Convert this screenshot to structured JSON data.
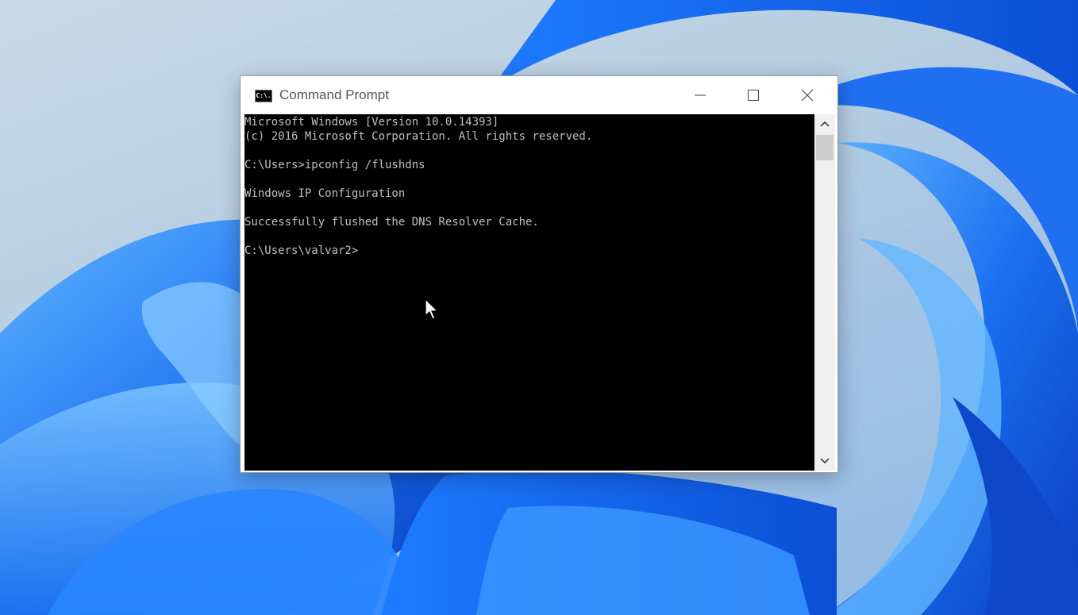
{
  "window": {
    "title": "Command Prompt",
    "icon": "cmd-app-icon",
    "icon_text": "C:\\."
  },
  "controls": {
    "minimize_icon": "minimize-icon",
    "maximize_icon": "maximize-icon",
    "close_icon": "close-icon"
  },
  "console": {
    "lines": [
      "Microsoft Windows [Version 10.0.14393]",
      "(c) 2016 Microsoft Corporation. All rights reserved.",
      "",
      "C:\\Users>ipconfig /flushdns",
      "",
      "Windows IP Configuration",
      "",
      "Successfully flushed the DNS Resolver Cache.",
      "",
      "C:\\Users\\valvar2>"
    ]
  },
  "scrollbar": {
    "up_icon": "chevron-up-icon",
    "down_icon": "chevron-down-icon"
  },
  "colors": {
    "console_bg": "#000000",
    "console_fg": "#c0c0c0",
    "wallpaper_blue": "#1565e8"
  }
}
